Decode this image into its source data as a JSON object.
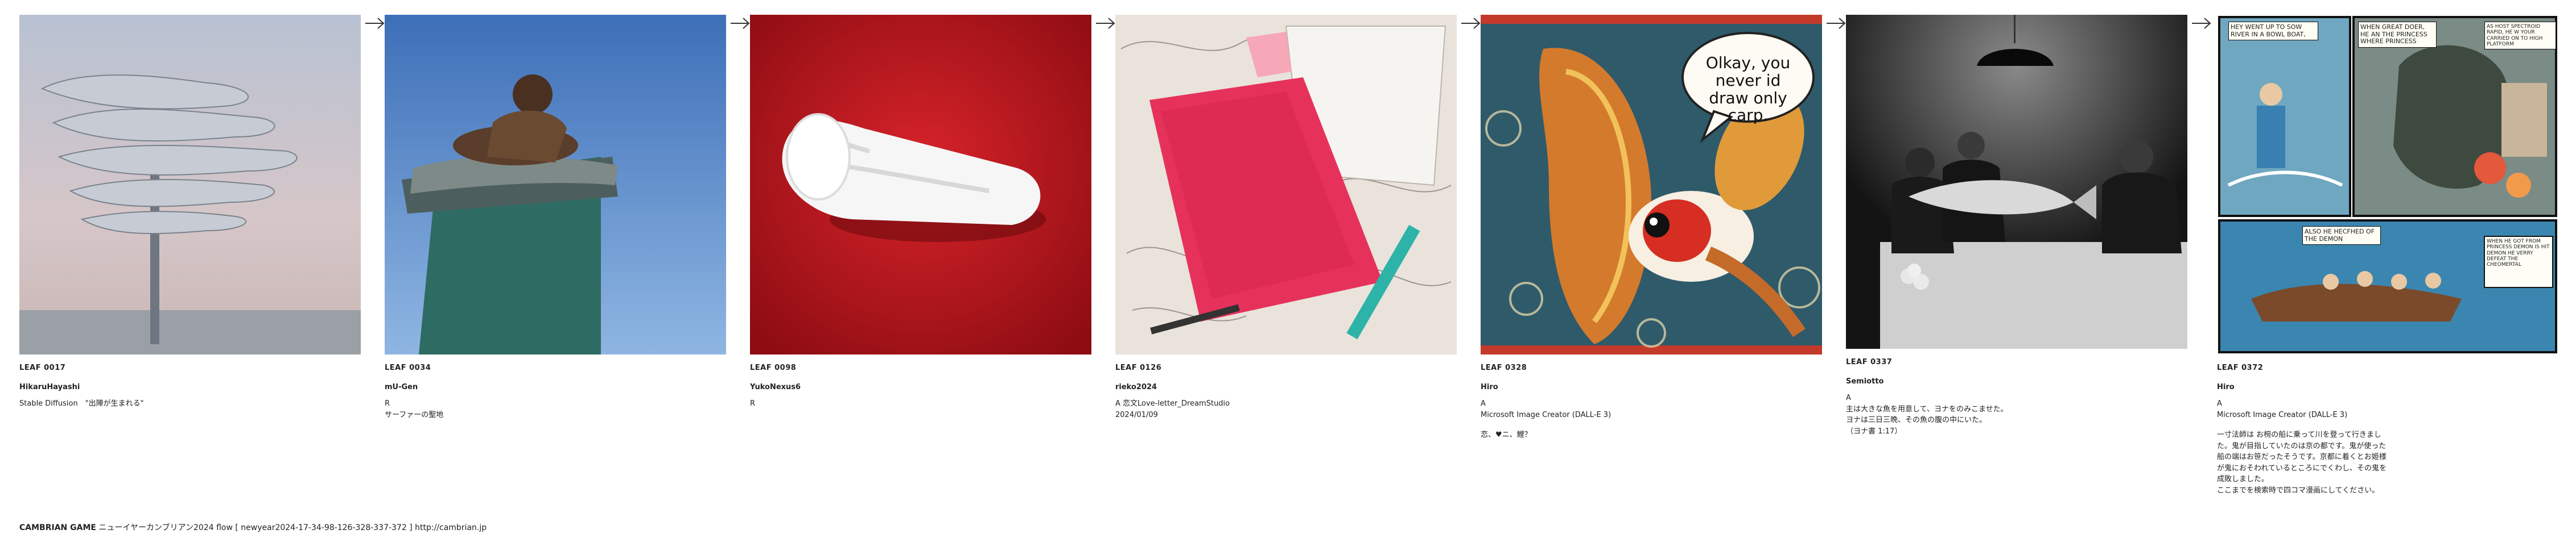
{
  "leaves": [
    {
      "id": "LEAF 0017",
      "author": "HikaruHayashi",
      "tool": "Stable Diffusion　\"出陣が生まれる\"",
      "comment": ""
    },
    {
      "id": "LEAF 0034",
      "author": "mU-Gen",
      "tool": "R\nサーファーの聖地",
      "comment": ""
    },
    {
      "id": "LEAF 0098",
      "author": "YukoNexus6",
      "tool": "R",
      "comment": ""
    },
    {
      "id": "LEAF 0126",
      "author": "rieko2024",
      "tool": "A 恋文Love-letter_DreamStudio\n2024/01/09",
      "comment": ""
    },
    {
      "id": "LEAF 0328",
      "author": "Hiro",
      "tool": "A\nMicrosoft Image Creator (DALL-E 3)",
      "comment": "恋、♥ニ、鯉？"
    },
    {
      "id": "LEAF 0337",
      "author": "Semiotto",
      "tool": "A\n主は大きな魚を用意して、ヨナをのみこませた。\nヨナは三日三晩、その魚の腹の中にいた。\n（ヨナ書 1:17）",
      "comment": ""
    },
    {
      "id": "LEAF 0372",
      "author": "Hiro",
      "tool": "A\nMicrosoft Image Creator (DALL-E 3)",
      "comment": "一寸法師は お椀の船に乗って川を登って行きました。鬼が目指していたのは京の都です。鬼が使った船の端はお笹だったそうです。京都に着くとお姫様が鬼におそわれているところにでくわし、その鬼を成敗しました。\nここまでを検索時で四コマ漫画にしてください。"
    }
  ],
  "bubble_text": "Olkay, you never id draw only carp.",
  "comic_texts": [
    "HEY WENT UP TO SOW RIVER IN A BOWL BOAT,",
    "WHEN GREAT DOER, HE AN THE PRINCESS WHERE PRINCESS",
    "AS HOST SPECTROID RAPID, HE W YOUR CARRIED ON TO HIGH PLATFORM",
    "ALSO HE HECFHED OF THE DEMON",
    "WHEN HE GOT FROM PRINCESS DEMON IS HIT DEMON HE VERRY DEFEAT THE CHEOMERTAL"
  ],
  "footer": {
    "title": "CAMBRIAN GAME",
    "text": "ニューイヤーカンブリアン2024  flow [ newyear2024-17-34-98-126-328-337-372 ]    http://cambrian.jp"
  },
  "icons": {
    "arrow": "right-arrow-icon"
  }
}
